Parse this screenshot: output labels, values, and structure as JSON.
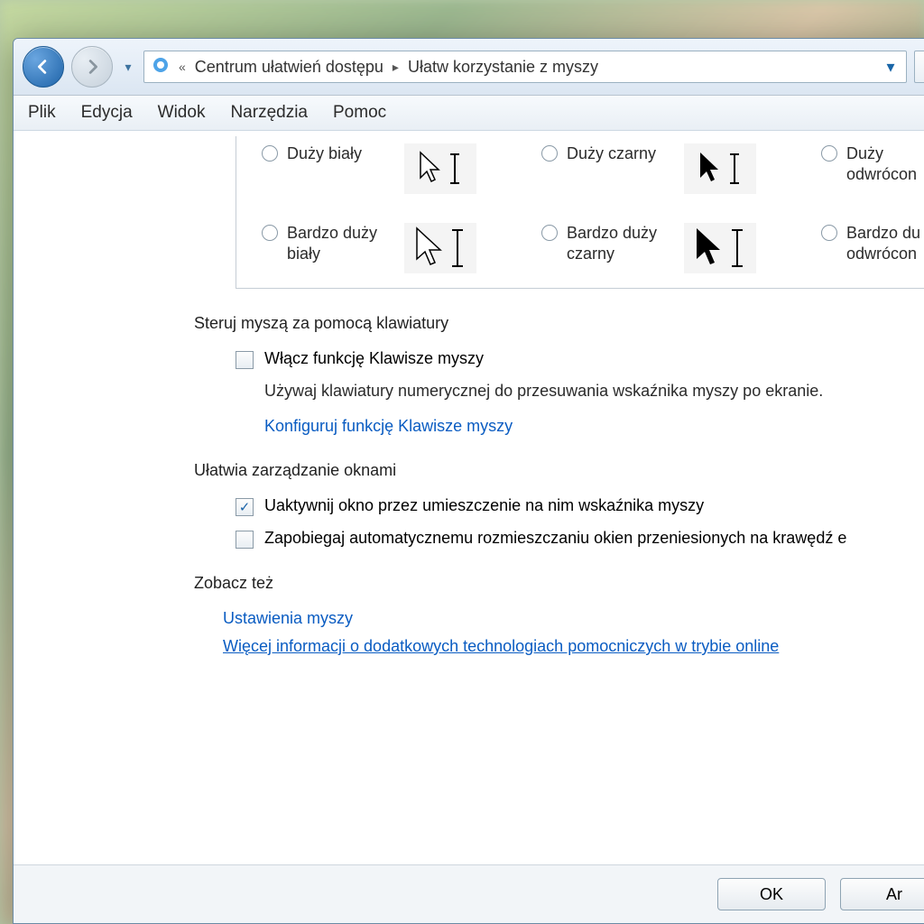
{
  "breadcrumb": {
    "parent": "Centrum ułatwień dostępu",
    "current": "Ułatw korzystanie z myszy"
  },
  "menu": {
    "file": "Plik",
    "edit": "Edycja",
    "view": "Widok",
    "tools": "Narzędzia",
    "help": "Pomoc"
  },
  "schemes": {
    "large_white": "Duży biały",
    "large_black": "Duży czarny",
    "large_inv": "Duży odwrócon",
    "xl_white": "Bardzo duży biały",
    "xl_black": "Bardzo duży czarny",
    "xl_inv": "Bardzo du odwrócon"
  },
  "section1": {
    "title": "Steruj myszą za pomocą klawiatury",
    "check_label": "Włącz funkcję Klawisze myszy",
    "help": "Używaj klawiatury numerycznej do przesuwania wskaźnika myszy po ekranie.",
    "config_link": "Konfiguruj funkcję Klawisze myszy"
  },
  "section2": {
    "title": "Ułatwia zarządzanie oknami",
    "check1": "Uaktywnij okno przez umieszczenie na nim wskaźnika myszy",
    "check2": "Zapobiegaj automatycznemu rozmieszczaniu okien przeniesionych na krawędź e"
  },
  "see_also": {
    "title": "Zobacz też",
    "link1": "Ustawienia myszy",
    "link2": "Więcej informacji o dodatkowych technologiach pomocniczych w trybie online"
  },
  "buttons": {
    "ok": "OK",
    "cancel": "Ar"
  }
}
